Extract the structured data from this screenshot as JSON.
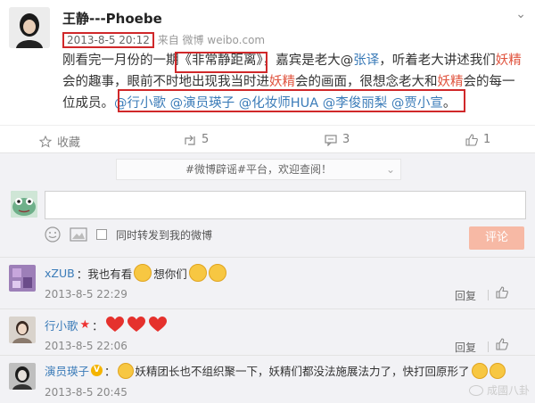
{
  "post": {
    "username": "王静---Phoebe",
    "timestamp": "2013-8-5 20:12",
    "source_prefix": "来自",
    "source_app": "微博",
    "source_site": "weibo.com",
    "text_segments": [
      {
        "t": "刚看完一月份的一期《非常静距离》，嘉宾是老大@",
        "c": "n"
      },
      {
        "t": "张译",
        "c": "at"
      },
      {
        "t": "，听着老大讲述我们",
        "c": "n"
      },
      {
        "t": "妖精",
        "c": "hl"
      },
      {
        "t": "会的趣事，眼前不时地出现我当时进",
        "c": "n"
      },
      {
        "t": "妖精",
        "c": "hl"
      },
      {
        "t": "会的画面，很想念老大和",
        "c": "n"
      },
      {
        "t": "妖精",
        "c": "hl"
      },
      {
        "t": "会的每一位成员。",
        "c": "n"
      },
      {
        "t": "@行小歌 @演员瑛子 @化妆师HUA @李俊丽梨 @贾小宣",
        "c": "at"
      },
      {
        "t": "。",
        "c": "n"
      }
    ]
  },
  "actions": {
    "collect": "收藏",
    "repost_count": "5",
    "comment_count": "3",
    "like_count": "1"
  },
  "comment_box": {
    "notice": "#微博辟谣#平台，欢迎查阅！",
    "repost_checkbox_label": "同时转发到我的微博",
    "submit_label": "评论"
  },
  "comments": [
    {
      "name": "xZUB",
      "text_before": "：我也有看",
      "text_after": "想你们",
      "time": "2013-8-5 22:29",
      "reply": "回复"
    },
    {
      "name": "行小歌",
      "text_before": "：",
      "text_after": "",
      "time": "2013-8-5 22:06",
      "reply": "回复"
    },
    {
      "name": "演员瑛子",
      "text_before": "：",
      "text_after": "妖精团长也不组织聚一下，妖精们都没法施展法力了，快打回原形了",
      "time": "2013-8-5 20:45",
      "reply": "回复"
    }
  ],
  "watermark": "成國八卦",
  "colors": {
    "accent_red": "#d0282a",
    "link_blue": "#3a7bb8",
    "highlight_orange": "#e0543f",
    "submit_bg": "#f7b9a5"
  }
}
